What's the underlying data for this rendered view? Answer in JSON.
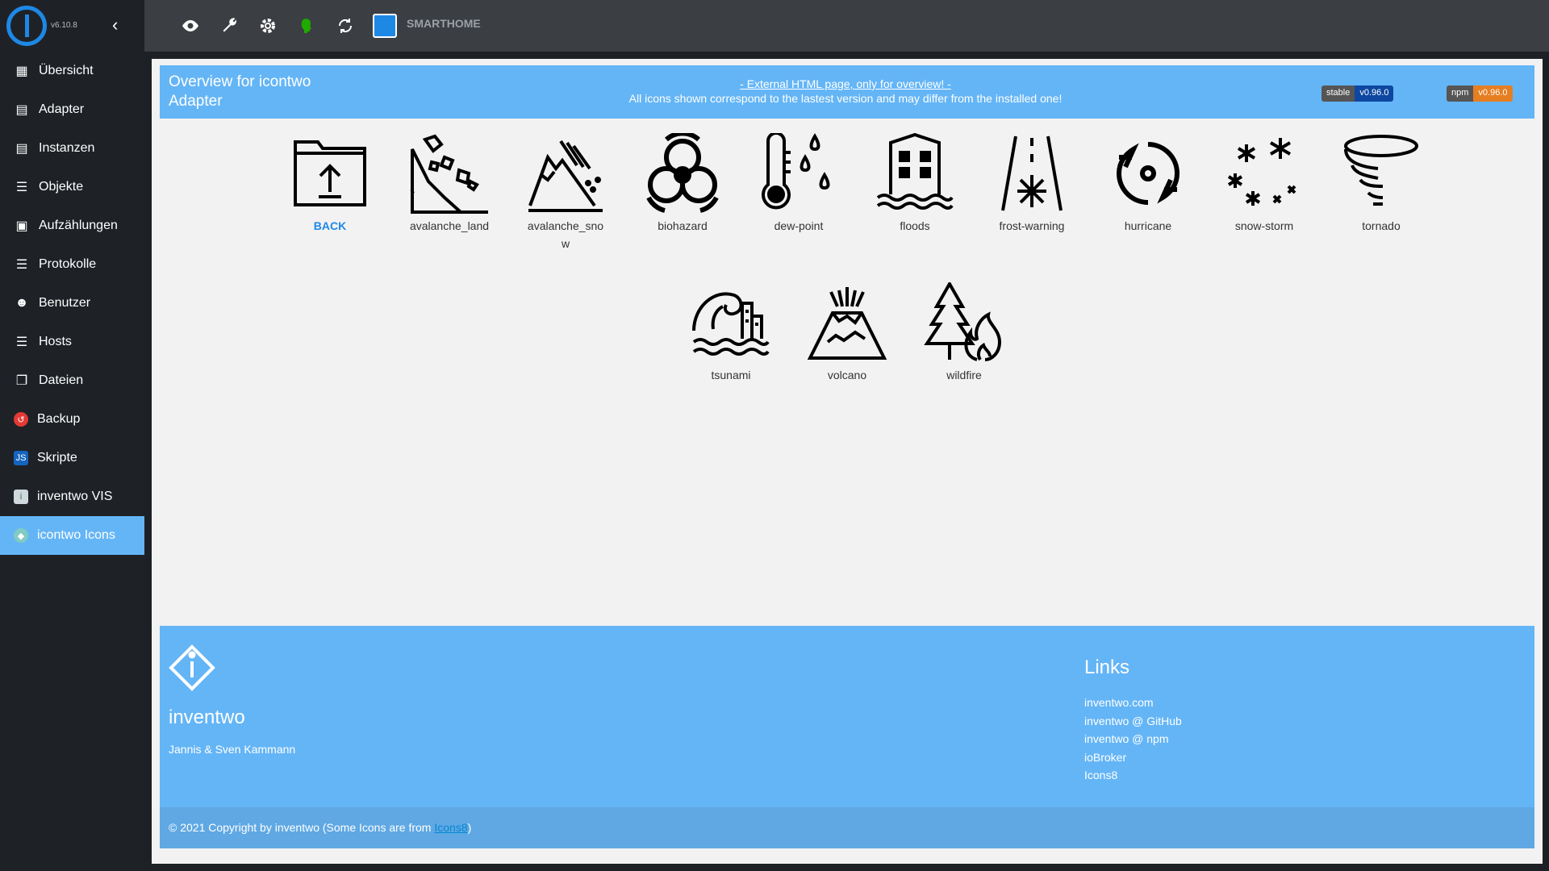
{
  "sidebar": {
    "version": "v6.10.8",
    "items": [
      {
        "label": "Übersicht",
        "icon": "grid-icon"
      },
      {
        "label": "Adapter",
        "icon": "store-icon"
      },
      {
        "label": "Instanzen",
        "icon": "instances-icon"
      },
      {
        "label": "Objekte",
        "icon": "list-icon"
      },
      {
        "label": "Aufzählungen",
        "icon": "enum-icon"
      },
      {
        "label": "Protokolle",
        "icon": "logs-icon"
      },
      {
        "label": "Benutzer",
        "icon": "user-icon"
      },
      {
        "label": "Hosts",
        "icon": "hosts-icon"
      },
      {
        "label": "Dateien",
        "icon": "files-icon"
      },
      {
        "label": "Backup",
        "icon": "backup-icon"
      },
      {
        "label": "Skripte",
        "icon": "js-icon"
      },
      {
        "label": "inventwo VIS",
        "icon": "inventwo-vis-icon"
      },
      {
        "label": "icontwo Icons",
        "icon": "icontwo-icon"
      }
    ],
    "active_index": 12
  },
  "toolbar": {
    "brand": "SMARTHOME"
  },
  "header": {
    "title": "Overview for icontwo Adapter",
    "link": "- External HTML page, only for overview! -",
    "subtitle": "All icons shown correspond to the lastest version and may differ from the installed one!",
    "badge_stable_label": "stable",
    "badge_stable_version": "v0.96.0",
    "badge_npm_label": "npm",
    "badge_npm_version": "v0.96.0"
  },
  "dash_text": "-.",
  "icons": [
    {
      "label": "BACK"
    },
    {
      "label": "avalanche_land"
    },
    {
      "label": "avalanche_snow"
    },
    {
      "label": "biohazard"
    },
    {
      "label": "dew-point"
    },
    {
      "label": "floods"
    },
    {
      "label": "frost-warning"
    },
    {
      "label": "hurricane"
    },
    {
      "label": "snow-storm"
    },
    {
      "label": "tornado"
    },
    {
      "label": "tsunami"
    },
    {
      "label": "volcano"
    },
    {
      "label": "wildfire"
    }
  ],
  "footer": {
    "name": "inventwo",
    "authors": "Jannis & Sven Kammann",
    "links_title": "Links",
    "links": [
      "inventwo.com",
      "inventwo @ GitHub",
      "inventwo @ npm",
      "ioBroker",
      "Icons8"
    ],
    "copyright": "© 2021 Copyright by inventwo (Some Icons are from ",
    "copyright_link": "Icons8",
    "copyright_end": ")"
  }
}
